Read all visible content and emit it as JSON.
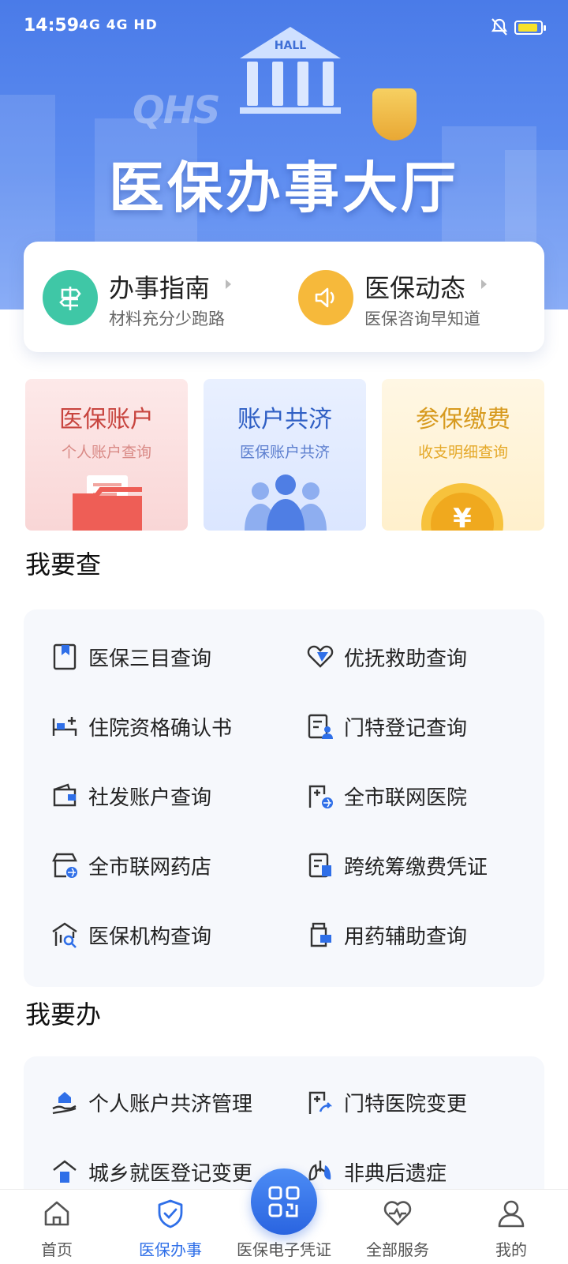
{
  "status_bar": {
    "time": "14:59",
    "network": "4G 4G HD",
    "colors": {
      "battery": "#f7e22a"
    }
  },
  "hero": {
    "hall_label": "HALL",
    "logo_text": "QHS",
    "title": "医保办事大厅"
  },
  "guide": {
    "left": {
      "title": "办事指南",
      "subtitle": "材料充分少跑路",
      "icon": "signpost-icon",
      "color": "#3fc7a6"
    },
    "right": {
      "title": "医保动态",
      "subtitle": "医保咨询早知道",
      "icon": "speaker-icon",
      "color": "#f6b93b"
    }
  },
  "tiles": [
    {
      "title": "医保账户",
      "subtitle": "个人账户查询",
      "color": "#c8453f",
      "bg": "#fbe3e3"
    },
    {
      "title": "账户共济",
      "subtitle": "医保账户共济",
      "color": "#2f5fc4",
      "bg": "#e6eeff"
    },
    {
      "title": "参保缴费",
      "subtitle": "收支明细查询",
      "color": "#d79a1e",
      "bg": "#fff4dc"
    }
  ],
  "query_section": {
    "title": "我要查",
    "items": [
      {
        "label": "医保三目查询",
        "icon": "bookmark-icon"
      },
      {
        "label": "优抚救助查询",
        "icon": "heart-hand-icon"
      },
      {
        "label": "住院资格确认书",
        "icon": "hospital-bed-icon"
      },
      {
        "label": "门特登记查询",
        "icon": "register-user-icon"
      },
      {
        "label": "社发账户查询",
        "icon": "wallet-icon"
      },
      {
        "label": "全市联网医院",
        "icon": "hospital-network-icon"
      },
      {
        "label": "全市联网药店",
        "icon": "pharmacy-icon"
      },
      {
        "label": "跨统筹缴费凭证",
        "icon": "receipt-icon"
      },
      {
        "label": "医保机构查询",
        "icon": "institution-search-icon"
      },
      {
        "label": "用药辅助查询",
        "icon": "medicine-bottle-icon"
      }
    ]
  },
  "handle_section": {
    "title": "我要办",
    "items": [
      {
        "label": "个人账户共济管理",
        "icon": "hand-house-icon"
      },
      {
        "label": "门特医院变更",
        "icon": "hospital-change-icon"
      },
      {
        "label": "城乡就医登记变更",
        "icon": "house-icon"
      },
      {
        "label": "非典后遗症",
        "icon": "lungs-icon"
      }
    ]
  },
  "tabbar": {
    "tabs": [
      {
        "label": "首页",
        "icon": "home-icon"
      },
      {
        "label": "医保办事",
        "icon": "shield-check-icon"
      },
      {
        "label": "医保电子凭证",
        "icon": "qr-code-icon"
      },
      {
        "label": "全部服务",
        "icon": "heart-pulse-icon"
      },
      {
        "label": "我的",
        "icon": "user-icon"
      }
    ],
    "active_color": "#2f6fe8"
  }
}
